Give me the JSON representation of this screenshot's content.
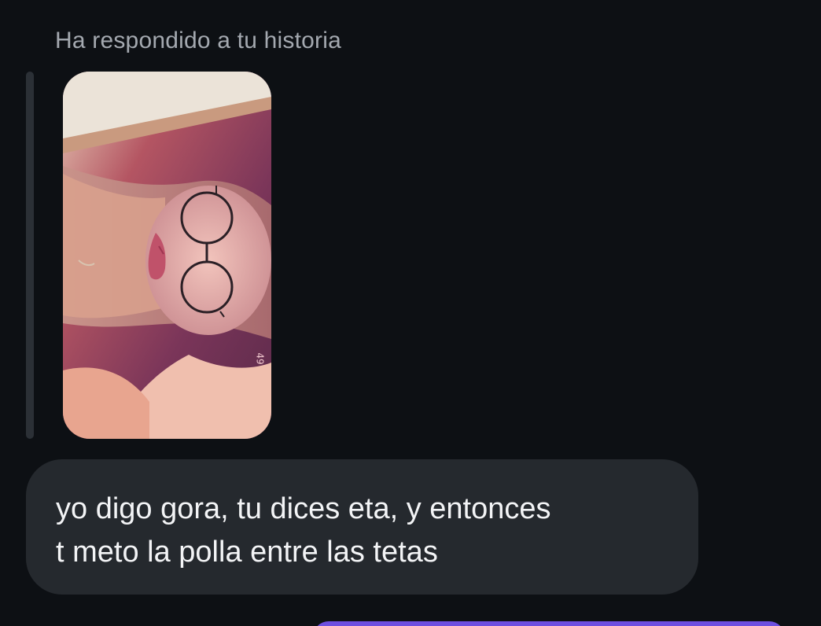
{
  "reply_context": {
    "label": "Ha respondido a tu historia"
  },
  "story_preview": {
    "counter": "49"
  },
  "message": {
    "text": "yo digo gora, tu dices eta, y entonces\nt meto la polla entre las tetas"
  },
  "colors": {
    "background": "#0d1014",
    "incoming_bubble": "#25292e",
    "outgoing_bubble": "#6d4fe0",
    "muted_text": "#a4a9b0",
    "message_text": "#f3f4f6"
  }
}
